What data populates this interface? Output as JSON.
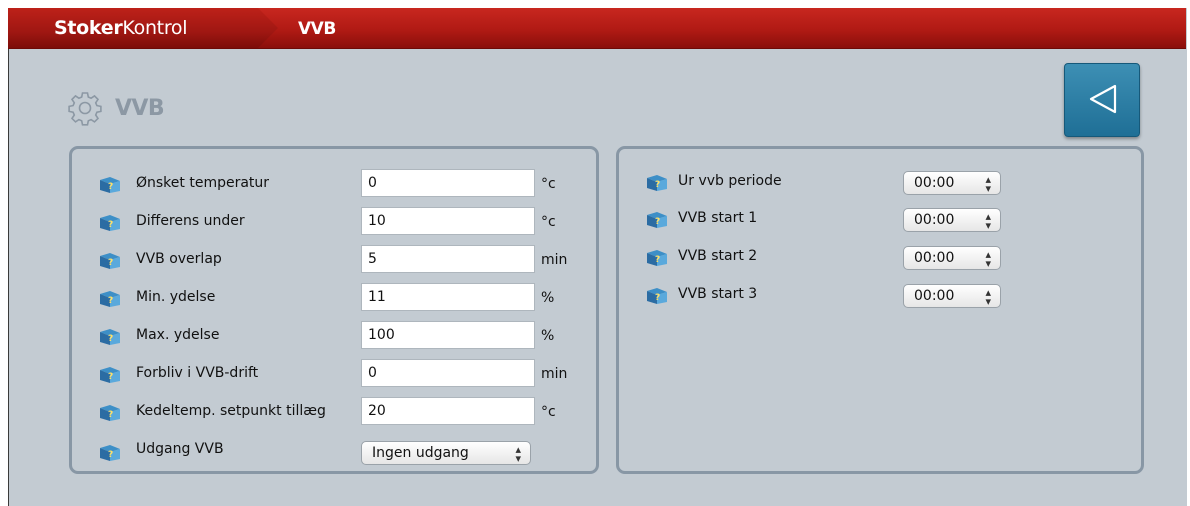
{
  "header": {
    "brand_bold": "Stoker",
    "brand_light": "Kontrol",
    "breadcrumb": "VVB"
  },
  "page": {
    "title": "VVB",
    "icon": "gear-icon",
    "back_icon": "triangle-left-icon"
  },
  "left_panel": {
    "rows": [
      {
        "label": "Ønsket temperatur",
        "value": "0",
        "unit": "°c"
      },
      {
        "label": "Differens under",
        "value": "10",
        "unit": "°c"
      },
      {
        "label": "VVB overlap",
        "value": "5",
        "unit": "min"
      },
      {
        "label": "Min. ydelse",
        "value": "11",
        "unit": "%"
      },
      {
        "label": "Max. ydelse",
        "value": "100",
        "unit": "%"
      },
      {
        "label": "Forbliv i VVB-drift",
        "value": "0",
        "unit": "min"
      },
      {
        "label": "Kedeltemp. setpunkt tillæg",
        "value": "20",
        "unit": "°c"
      }
    ],
    "output": {
      "label": "Udgang VVB",
      "selected": "Ingen udgang"
    }
  },
  "right_panel": {
    "rows": [
      {
        "label": "Ur vvb periode",
        "selected": "00:00"
      },
      {
        "label": "VVB start 1",
        "selected": "00:00"
      },
      {
        "label": "VVB start 2",
        "selected": "00:00"
      },
      {
        "label": "VVB start 3",
        "selected": "00:00"
      }
    ]
  },
  "colors": {
    "header_red": "#b01a14",
    "background": "#c3cbd2",
    "panel_border": "#8897a5",
    "accent_blue": "#2a7da6"
  }
}
